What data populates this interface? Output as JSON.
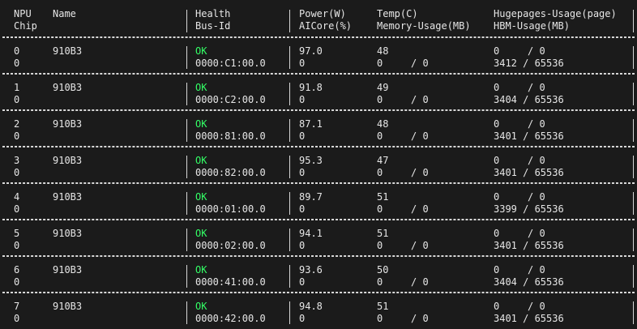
{
  "header": {
    "npu": "NPU",
    "chip": "Chip",
    "name": "Name",
    "health": "Health",
    "bus_id": "Bus-Id",
    "power": "Power(W)",
    "aicore": "AICore(%)",
    "temp": "Temp(C)",
    "memory_usage": "Memory-Usage(MB)",
    "hugepages_usage": "Hugepages-Usage(page)",
    "hbm_usage": "HBM-Usage(MB)"
  },
  "devices": [
    {
      "npu": "0",
      "chip": "0",
      "name": "910B3",
      "health": "OK",
      "bus_id": "0000:C1:00.0",
      "power": "97.0",
      "aicore": "0",
      "temp": "48",
      "mem_used": "0",
      "mem_total": "/ 0",
      "huge_used": "0",
      "huge_total": "/ 0",
      "hbm": "3412 / 65536"
    },
    {
      "npu": "1",
      "chip": "0",
      "name": "910B3",
      "health": "OK",
      "bus_id": "0000:C2:00.0",
      "power": "91.8",
      "aicore": "0",
      "temp": "49",
      "mem_used": "0",
      "mem_total": "/ 0",
      "huge_used": "0",
      "huge_total": "/ 0",
      "hbm": "3404 / 65536"
    },
    {
      "npu": "2",
      "chip": "0",
      "name": "910B3",
      "health": "OK",
      "bus_id": "0000:81:00.0",
      "power": "87.1",
      "aicore": "0",
      "temp": "48",
      "mem_used": "0",
      "mem_total": "/ 0",
      "huge_used": "0",
      "huge_total": "/ 0",
      "hbm": "3401 / 65536"
    },
    {
      "npu": "3",
      "chip": "0",
      "name": "910B3",
      "health": "OK",
      "bus_id": "0000:82:00.0",
      "power": "95.3",
      "aicore": "0",
      "temp": "47",
      "mem_used": "0",
      "mem_total": "/ 0",
      "huge_used": "0",
      "huge_total": "/ 0",
      "hbm": "3401 / 65536"
    },
    {
      "npu": "4",
      "chip": "0",
      "name": "910B3",
      "health": "OK",
      "bus_id": "0000:01:00.0",
      "power": "89.7",
      "aicore": "0",
      "temp": "51",
      "mem_used": "0",
      "mem_total": "/ 0",
      "huge_used": "0",
      "huge_total": "/ 0",
      "hbm": "3399 / 65536"
    },
    {
      "npu": "5",
      "chip": "0",
      "name": "910B3",
      "health": "OK",
      "bus_id": "0000:02:00.0",
      "power": "94.1",
      "aicore": "0",
      "temp": "51",
      "mem_used": "0",
      "mem_total": "/ 0",
      "huge_used": "0",
      "huge_total": "/ 0",
      "hbm": "3401 / 65536"
    },
    {
      "npu": "6",
      "chip": "0",
      "name": "910B3",
      "health": "OK",
      "bus_id": "0000:41:00.0",
      "power": "93.6",
      "aicore": "0",
      "temp": "50",
      "mem_used": "0",
      "mem_total": "/ 0",
      "huge_used": "0",
      "huge_total": "/ 0",
      "hbm": "3404 / 65536"
    },
    {
      "npu": "7",
      "chip": "0",
      "name": "910B3",
      "health": "OK",
      "bus_id": "0000:42:00.0",
      "power": "94.8",
      "aicore": "0",
      "temp": "51",
      "mem_used": "0",
      "mem_total": "/ 0",
      "huge_used": "0",
      "huge_total": "/ 0",
      "hbm": "3401 / 65536"
    }
  ],
  "colors": {
    "background": "#1b1b1b",
    "text": "#e6e6e6",
    "ok": "#33ff66",
    "border": "#d8d8d8"
  }
}
